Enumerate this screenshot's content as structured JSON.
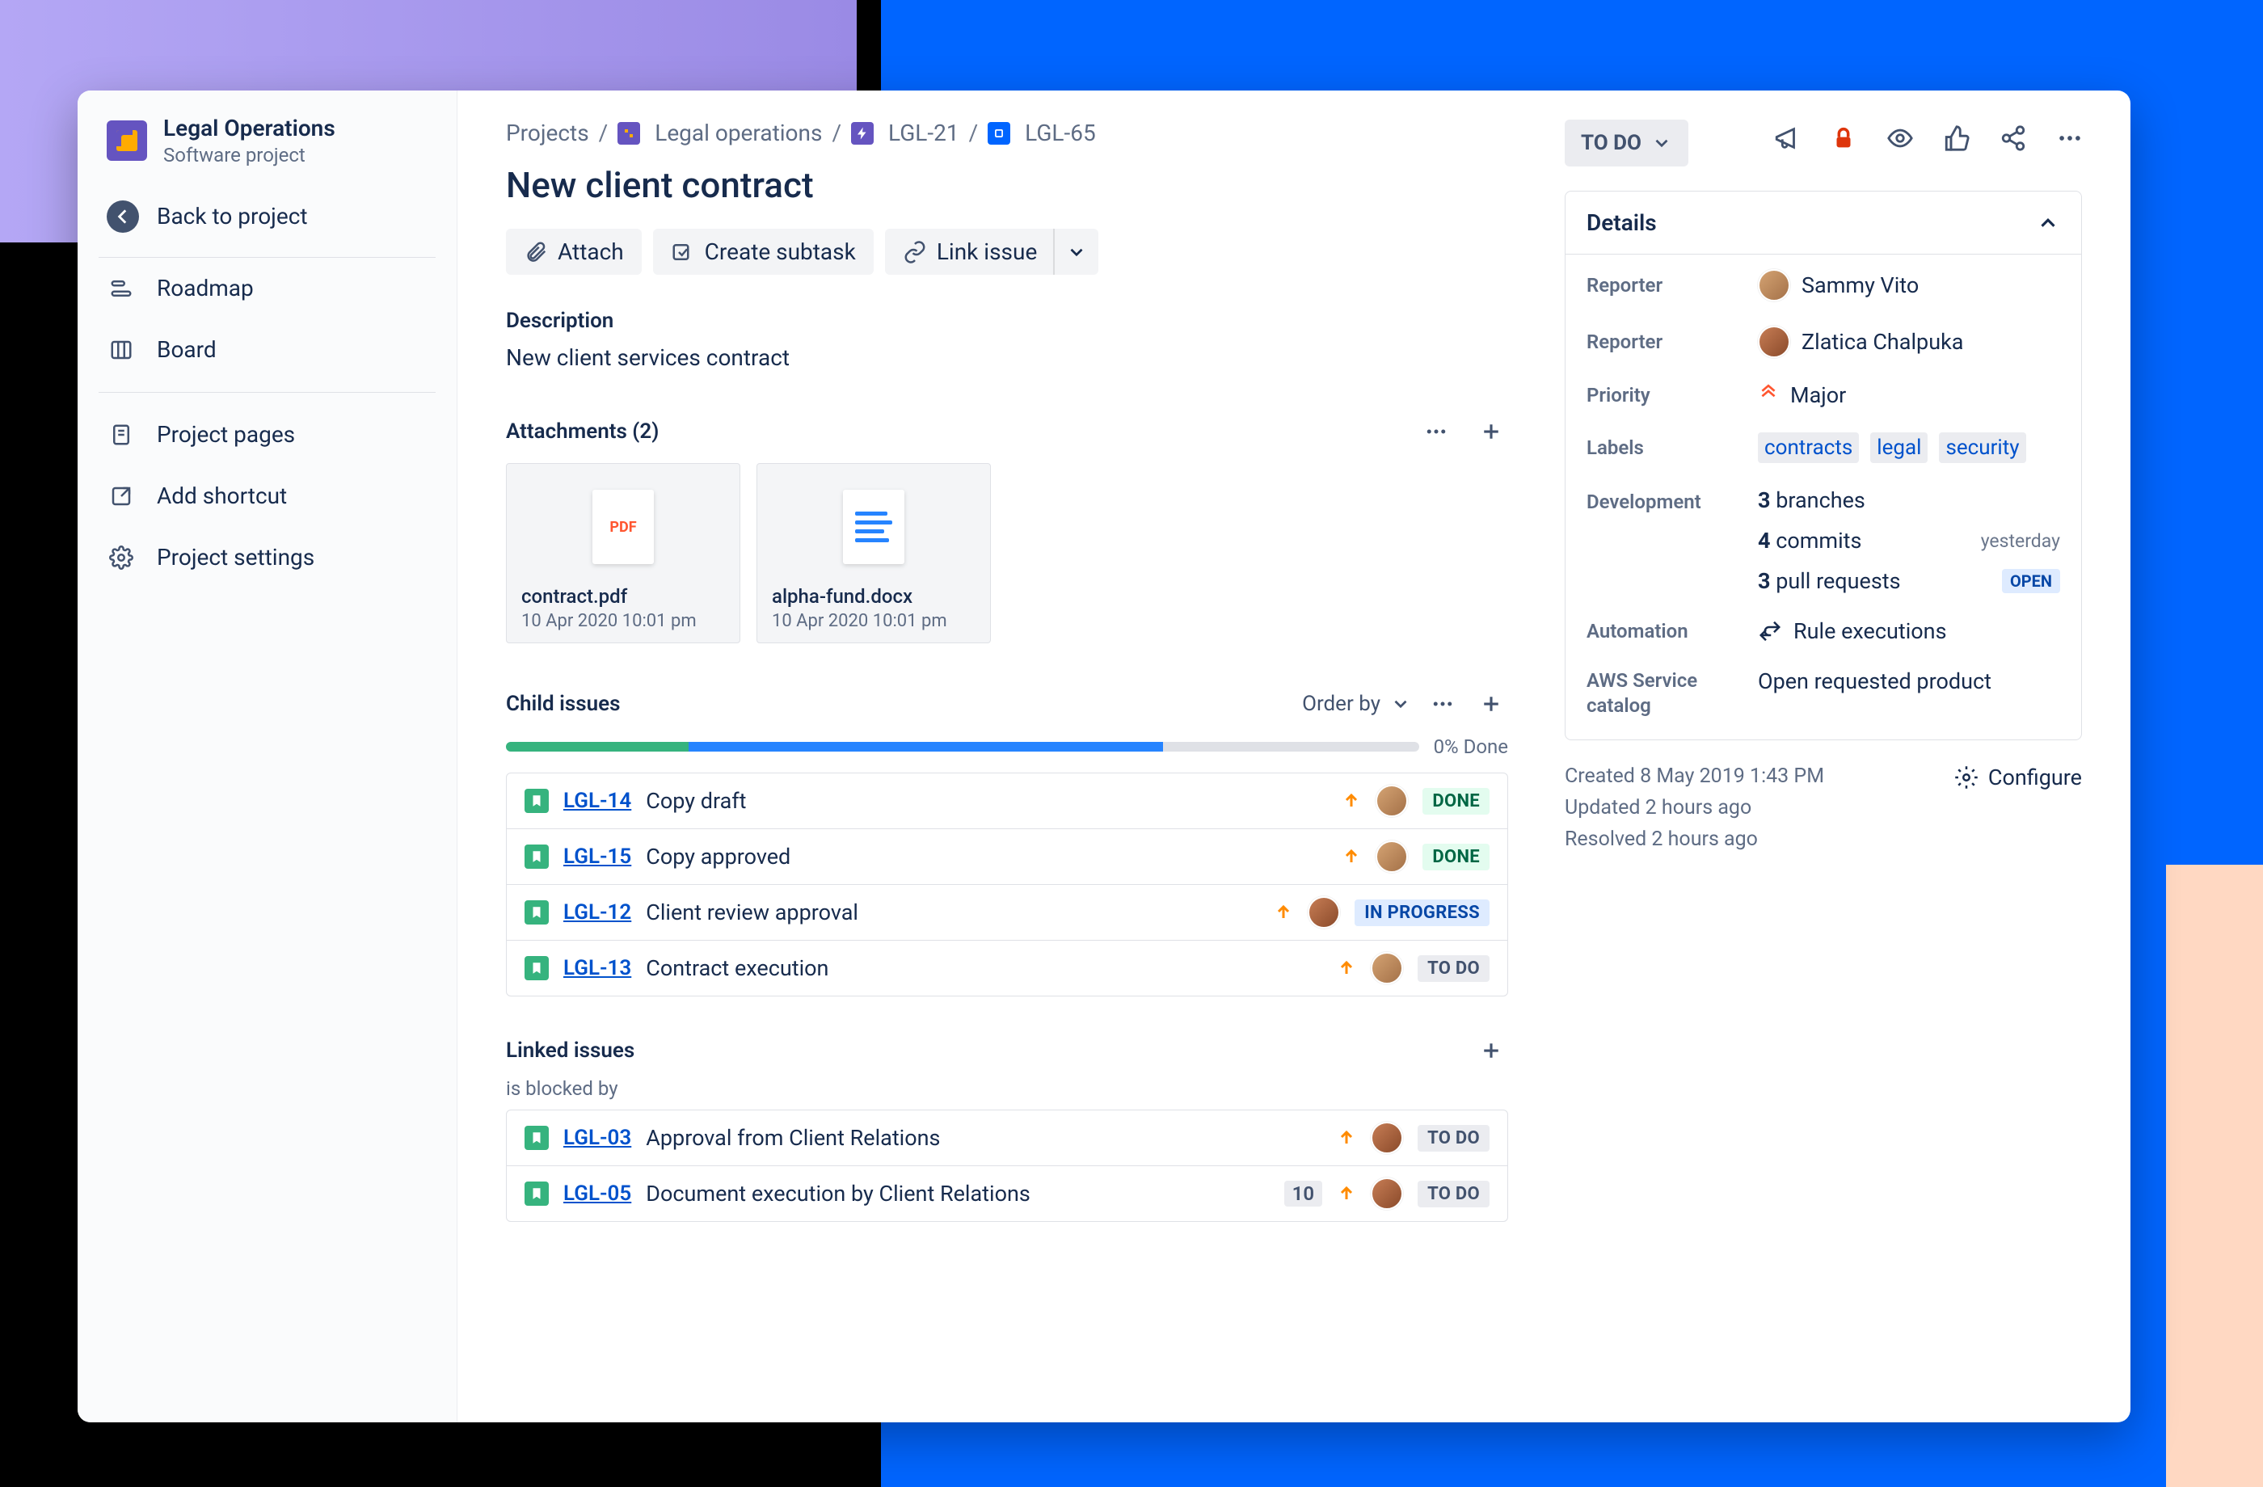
{
  "sidebar": {
    "project_title": "Legal Operations",
    "project_subtitle": "Software project",
    "back_label": "Back to project",
    "nav": [
      {
        "label": "Roadmap"
      },
      {
        "label": "Board"
      }
    ],
    "util": [
      {
        "label": "Project pages"
      },
      {
        "label": "Add shortcut"
      },
      {
        "label": "Project settings"
      }
    ]
  },
  "header_icons": [
    "megaphone-icon",
    "lock-icon",
    "eye-icon",
    "thumbs-up-icon",
    "share-icon",
    "more-icon"
  ],
  "breadcrumbs": {
    "root": "Projects",
    "project": "Legal operations",
    "parent_key": "LGL-21",
    "issue_key": "LGL-65"
  },
  "issue": {
    "title": "New client contract",
    "toolbar": {
      "attach": "Attach",
      "create_subtask": "Create subtask",
      "link_issue": "Link issue"
    },
    "description_h": "Description",
    "description": "New client services contract"
  },
  "attachments": {
    "heading": "Attachments (2)",
    "items": [
      {
        "name": "contract.pdf",
        "meta": "10 Apr 2020 10:01 pm",
        "kind": "pdf"
      },
      {
        "name": "alpha-fund.docx",
        "meta": "10 Apr 2020 10:01 pm",
        "kind": "docx"
      }
    ]
  },
  "child": {
    "heading": "Child issues",
    "order_by": "Order by",
    "progress_pct_label": "0% Done",
    "segments": {
      "done": 20,
      "progress": 52,
      "rest": 28
    },
    "items": [
      {
        "key": "LGL-14",
        "summary": "Copy draft",
        "status": "DONE",
        "status_cls": "st-done",
        "avatar": "a1"
      },
      {
        "key": "LGL-15",
        "summary": "Copy approved",
        "status": "DONE",
        "status_cls": "st-done",
        "avatar": "a1"
      },
      {
        "key": "LGL-12",
        "summary": "Client review approval",
        "status": "IN PROGRESS",
        "status_cls": "st-prog",
        "avatar": "a2"
      },
      {
        "key": "LGL-13",
        "summary": "Contract execution",
        "status": "TO DO",
        "status_cls": "st-todo",
        "avatar": "a1"
      }
    ]
  },
  "linked": {
    "heading": "Linked issues",
    "relation": "is blocked by",
    "items": [
      {
        "key": "LGL-03",
        "summary": "Approval from Client Relations",
        "status": "TO DO",
        "status_cls": "st-todo",
        "avatar": "a2",
        "count": null
      },
      {
        "key": "LGL-05",
        "summary": "Document execution by Client Relations",
        "status": "TO DO",
        "status_cls": "st-todo",
        "avatar": "a2",
        "count": "10"
      }
    ]
  },
  "panel": {
    "status": "TO DO",
    "details_h": "Details",
    "rows": {
      "reporter1_l": "Reporter",
      "reporter1_v": "Sammy Vito",
      "reporter2_l": "Reporter",
      "reporter2_v": "Zlatica Chalpuka",
      "priority_l": "Priority",
      "priority_v": "Major",
      "labels_l": "Labels",
      "labels": [
        "contracts",
        "legal",
        "security"
      ],
      "dev_l": "Development",
      "dev": [
        {
          "n": "3",
          "t": "branches",
          "meta": ""
        },
        {
          "n": "4",
          "t": "commits",
          "meta": "yesterday"
        },
        {
          "n": "3",
          "t": "pull requests",
          "meta": "OPEN",
          "badge": true
        }
      ],
      "automation_l": "Automation",
      "automation_v": "Rule executions",
      "aws_l": "AWS Service catalog",
      "aws_v": "Open requested product"
    },
    "meta": {
      "created": "Created 8 May 2019 1:43 PM",
      "updated": "Updated 2 hours ago",
      "resolved": "Resolved 2 hours ago",
      "configure": "Configure"
    }
  }
}
